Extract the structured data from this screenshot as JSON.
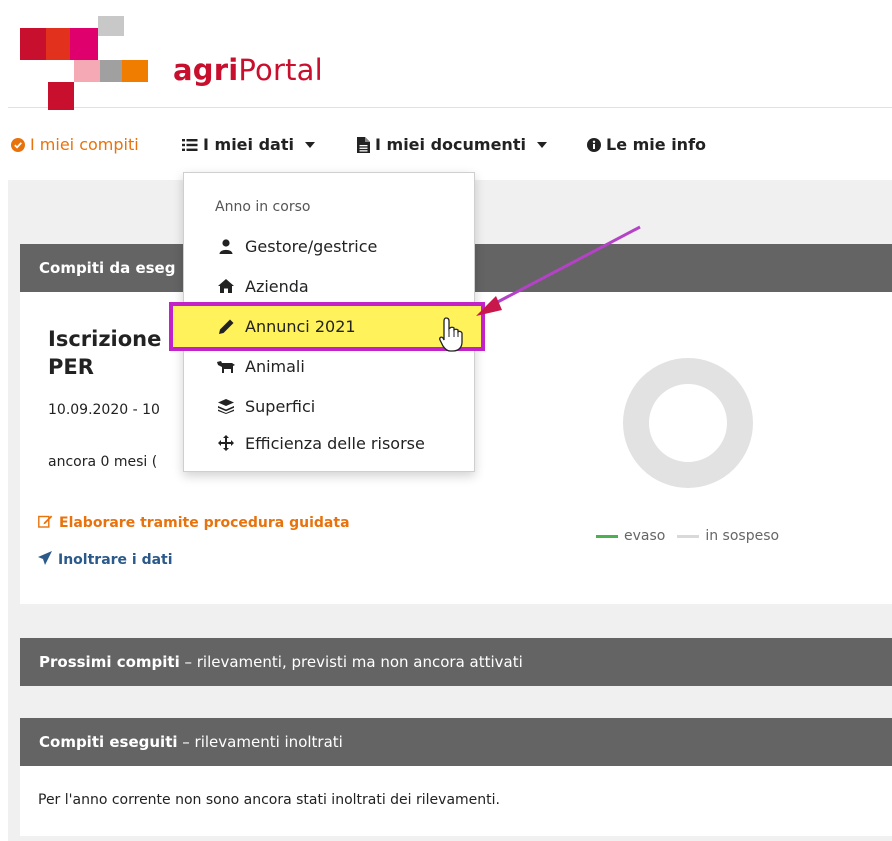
{
  "header": {
    "brand_bold": "agri",
    "brand_rest": "Portal"
  },
  "nav": {
    "items": [
      {
        "label": "I miei compiti",
        "icon": "check-circle-icon"
      },
      {
        "label": "I miei dati",
        "icon": "list-icon"
      },
      {
        "label": "I miei documenti",
        "icon": "file-icon"
      },
      {
        "label": "Le mie info",
        "icon": "info-circle-icon"
      }
    ]
  },
  "dropdown": {
    "header": "Anno in corso",
    "items": [
      {
        "label": "Gestore/gestrice",
        "icon": "user-icon"
      },
      {
        "label": "Azienda",
        "icon": "home-icon"
      },
      {
        "label": "Annunci 2021",
        "icon": "pencil-icon"
      },
      {
        "label": "Animali",
        "icon": "cow-icon"
      },
      {
        "label": "Superfici",
        "icon": "layers-icon"
      },
      {
        "label": "Efficienza delle risorse",
        "icon": "arrows-icon"
      }
    ]
  },
  "current_tasks": {
    "heading": "Compiti da eseg",
    "title_line1": "Iscrizione a",
    "title_line2": "PER",
    "dates": "10.09.2020 - 10",
    "remaining": "ancora 0 mesi (",
    "edit_link": "Elaborare tramite procedura guidata",
    "submit_link": "Inoltrare i dati",
    "legend_done": "evaso",
    "legend_pending": "in sospeso",
    "progress_done": 0
  },
  "next_tasks": {
    "heading_bold": "Prossimi compiti",
    "heading_rest": " – rilevamenti, previsti ma non ancora attivati"
  },
  "done_tasks": {
    "heading_bold": "Compiti eseguiti",
    "heading_rest": " – rilevamenti inoltrati",
    "message": "Per l'anno corrente non sono ancora stati inoltrati dei rilevamenti."
  },
  "colors": {
    "brand_red": "#c8102e",
    "orange": "#e8720c",
    "highlight_yellow": "#fff25a",
    "highlight_border": "#c223c9",
    "panel_head": "#646464",
    "donut_pending": "#e2e2e2",
    "legend_done": "#4caf50"
  }
}
